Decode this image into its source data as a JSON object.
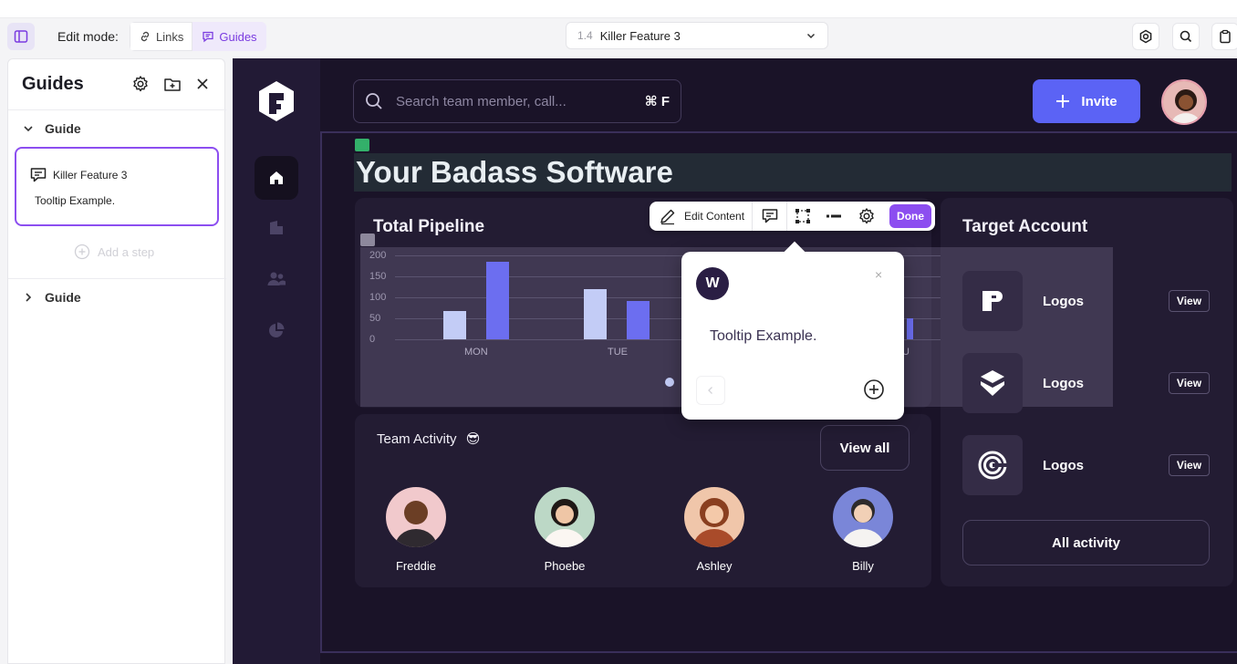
{
  "topbar": {
    "edit_mode_label": "Edit mode:",
    "modes": [
      {
        "label": "Links",
        "icon": "link-icon",
        "active": false
      },
      {
        "label": "Guides",
        "icon": "guides-icon",
        "active": true
      }
    ],
    "step_select": {
      "number": "1.4",
      "title": "Killer Feature 3"
    },
    "accent": "#8c4ef0"
  },
  "sidebar": {
    "title": "Guides",
    "guides": [
      {
        "label": "Guide",
        "expanded": true
      },
      {
        "label": "Guide",
        "expanded": false
      }
    ],
    "step": {
      "title": "Killer Feature 3",
      "description": "Tooltip Example."
    },
    "add_step_label": "Add a step"
  },
  "app": {
    "search_placeholder": "Search team member, call...",
    "search_shortcut": "⌘ F",
    "invite_label": "Invite",
    "page_title": "Your Badass Software",
    "brand_color": "#5b63f5",
    "pipeline": {
      "title": "Total Pipeline",
      "y_ticks": [
        "200",
        "150",
        "100",
        "50",
        "0"
      ],
      "x_labels": [
        "MON",
        "TUE",
        "U"
      ]
    },
    "target_account": {
      "title": "Target Account",
      "accounts": [
        {
          "name": "Logos",
          "view": "View",
          "icon": "p-logo-icon"
        },
        {
          "name": "Logos",
          "view": "View",
          "icon": "layers-logo-icon"
        },
        {
          "name": "Logos",
          "view": "View",
          "icon": "ring-logo-icon"
        }
      ],
      "all_activity": "All activity"
    },
    "team": {
      "title": "Team Activity",
      "emoji": "😎",
      "view_all": "View all",
      "members": [
        "Freddie",
        "Phoebe",
        "Ashley",
        "Billy"
      ]
    }
  },
  "editor_toolbar": {
    "edit_content": "Edit Content",
    "done": "Done"
  },
  "tooltip": {
    "logo_letter": "W",
    "close": "×",
    "text": "Tooltip Example."
  },
  "chart_data": {
    "type": "bar",
    "title": "Total Pipeline",
    "categories": [
      "MON",
      "TUE"
    ],
    "series": [
      {
        "values": [
          68,
          120
        ]
      },
      {
        "values": [
          185,
          92
        ]
      }
    ],
    "ylim": [
      0,
      200
    ],
    "grid": true
  }
}
